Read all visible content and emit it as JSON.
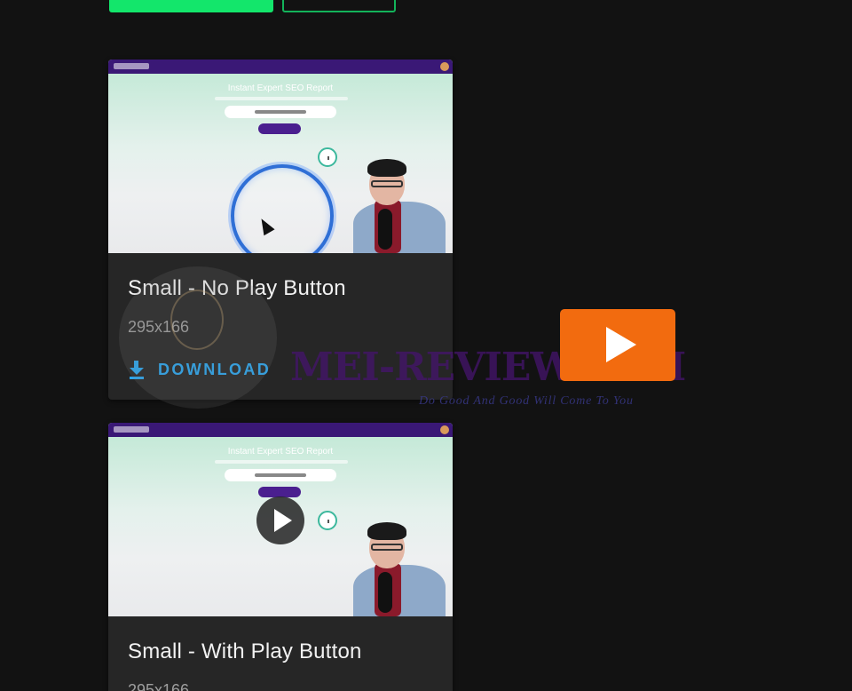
{
  "top_buttons": {
    "primary": "",
    "secondary": ""
  },
  "cards": [
    {
      "thumbnail": {
        "heading": "Instant Expert SEO Report"
      },
      "title": "Small - No Play Button",
      "size": "295x166",
      "download_label": "DOWNLOAD",
      "download_icon": "download-icon"
    },
    {
      "thumbnail": {
        "heading": "Instant Expert SEO Report"
      },
      "title": "Small - With Play Button",
      "size": "295x166"
    }
  ],
  "watermark": {
    "text": "MEI-REVIEW.COM",
    "tagline": "Do Good And Good Will Come To You"
  },
  "colors": {
    "background": "#121212",
    "card": "#262626",
    "accent_green": "#13e66b",
    "link_blue": "#2aa6f0",
    "video_play": "#f26b0f",
    "thumb_header": "#3a1876"
  }
}
